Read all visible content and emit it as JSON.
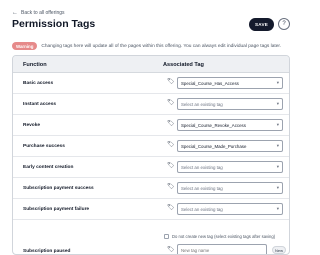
{
  "nav": {
    "back_label": "Back to all offerings"
  },
  "page": {
    "title": "Permission Tags"
  },
  "toolbar": {
    "save_label": "SAVE",
    "help_label": "?"
  },
  "warning": {
    "badge": "Warning",
    "text": "Changing tags here will update all of the pages within this offering. You can always edit individual page tags later."
  },
  "table": {
    "headers": {
      "function": "Function",
      "associated_tag": "Associated Tag"
    },
    "rows": [
      {
        "label": "Basic access",
        "value": "Special_Course_Has_Access",
        "placeholder": false
      },
      {
        "label": "Instant access",
        "value": "Select an existing tag",
        "placeholder": true
      },
      {
        "label": "Revoke",
        "value": "Special_Course_Revoke_Access",
        "placeholder": false
      },
      {
        "label": "Purchase success",
        "value": "Special_Course_Made_Purchase",
        "placeholder": false
      },
      {
        "label": "Early content creation",
        "value": "Select an existing tag",
        "placeholder": true
      },
      {
        "label": "Subscription payment success",
        "value": "Select an existing tag",
        "placeholder": true
      },
      {
        "label": "Subscription payment failure",
        "value": "Select an existing tag",
        "placeholder": true
      }
    ],
    "last_row": {
      "label": "Subscription paused",
      "input_placeholder": "New tag name",
      "new_button": "New",
      "checkbox_label": "Do not create new tag (select existing tags after saving)"
    }
  },
  "colors": {
    "save_bg": "#141a2c",
    "warning_badge": "#e68a8a",
    "header_bg": "#eef0f3"
  },
  "icons": {
    "back": "arrow-left-icon",
    "tag": "tag-icon",
    "dropdown": "chevron-down-icon",
    "help": "question-icon"
  }
}
